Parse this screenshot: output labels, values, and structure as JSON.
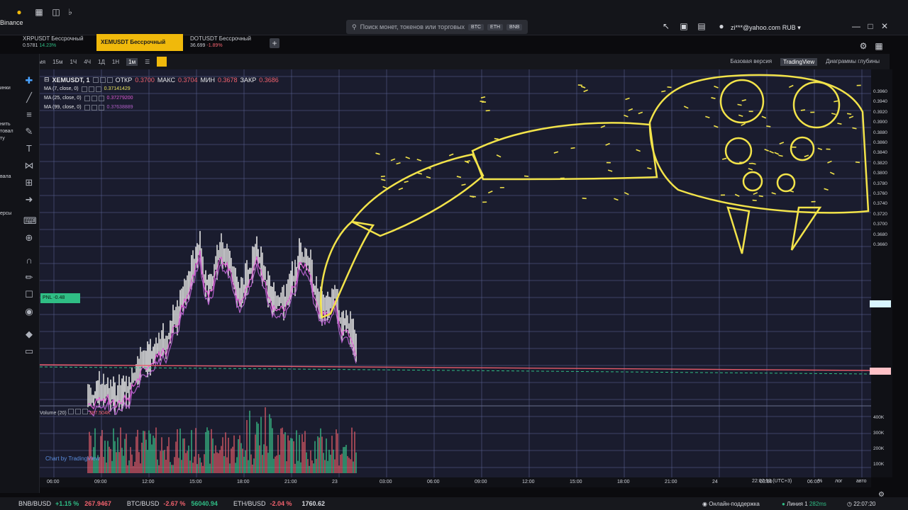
{
  "brand": "Binance",
  "search": {
    "placeholder": "Поиск монет, токенов или торговых",
    "pills": [
      "BTC",
      "ETH",
      "BNB"
    ]
  },
  "account": {
    "email": "zi***@yahoo.com",
    "currency": "RUB"
  },
  "tabs": [
    {
      "name": "XRPUSDT Бессрочный",
      "price": "0.5781",
      "change": "14.23%"
    },
    {
      "name": "XEMUSDT Бессрочный",
      "price": "",
      "change": ""
    },
    {
      "name": "DOTUSDT Бессрочный",
      "price": "36.699",
      "change": "-1.89%"
    }
  ],
  "toolbar": {
    "time_label": "Время",
    "timeframes": [
      "15м",
      "1Ч",
      "4Ч",
      "1Д",
      "1Н",
      "1м"
    ],
    "selected": "1м",
    "views": [
      "Базовая версия",
      "TradingView",
      "Диаграммы глубины"
    ],
    "active_view": "TradingView"
  },
  "side_labels": [
    "inance",
    "инки",
    "нить",
    "товал",
    "ту",
    "вала",
    "ерсы"
  ],
  "legend": {
    "symbol": "XEMUSDT, 1",
    "open_label": "ОТКР",
    "open": "0.3700",
    "high_label": "МАКС",
    "high": "0.3704",
    "low_label": "МИН",
    "low": "0.3678",
    "close_label": "ЗАКР",
    "close": "0.3686",
    "ma": [
      {
        "label": "MA (7, close, 0)",
        "value": "0.37141429"
      },
      {
        "label": "MA (25, close, 0)",
        "value": "0.37279200"
      },
      {
        "label": "MA (99, close, 0)",
        "value": "0.37638889"
      }
    ]
  },
  "pnl": "PNL -0.48",
  "volume": {
    "label": "Volume (20)",
    "value": "387.504K"
  },
  "tv_credit": "Chart by TradingView",
  "price_axis": [
    "0.3960",
    "0.3940",
    "0.3920",
    "0.3900",
    "0.3880",
    "0.3860",
    "0.3840",
    "0.3820",
    "0.3800",
    "0.3780",
    "0.3760",
    "0.3740",
    "0.3720",
    "0.3700",
    "0.3680",
    "0.3660"
  ],
  "vol_axis": [
    "400K",
    "300K",
    "200K",
    "100K"
  ],
  "time_axis": [
    "06:00",
    "09:00",
    "12:00",
    "15:00",
    "18:00",
    "21:00",
    "23",
    "03:00",
    "06:00",
    "09:00",
    "12:00",
    "15:00",
    "18:00",
    "21:00",
    "24",
    "03:00",
    "06:00"
  ],
  "time_bar": {
    "clock": "22:07:53 (UTC+3)",
    "pct": "%",
    "log": "лог",
    "auto": "авто"
  },
  "ticker": [
    {
      "pair": "BNB/BUSD",
      "change": "+1.15 %",
      "price": "267.9467"
    },
    {
      "pair": "BTC/BUSD",
      "change": "-2.67 %",
      "price": "56040.94"
    },
    {
      "pair": "ETH/BUSD",
      "change": "-2.04 %",
      "price": "1760.62"
    }
  ],
  "status": {
    "support": "Онлайн-поддержка",
    "line": "Линия 1",
    "ping": "282ms",
    "time": "22:07:20"
  }
}
